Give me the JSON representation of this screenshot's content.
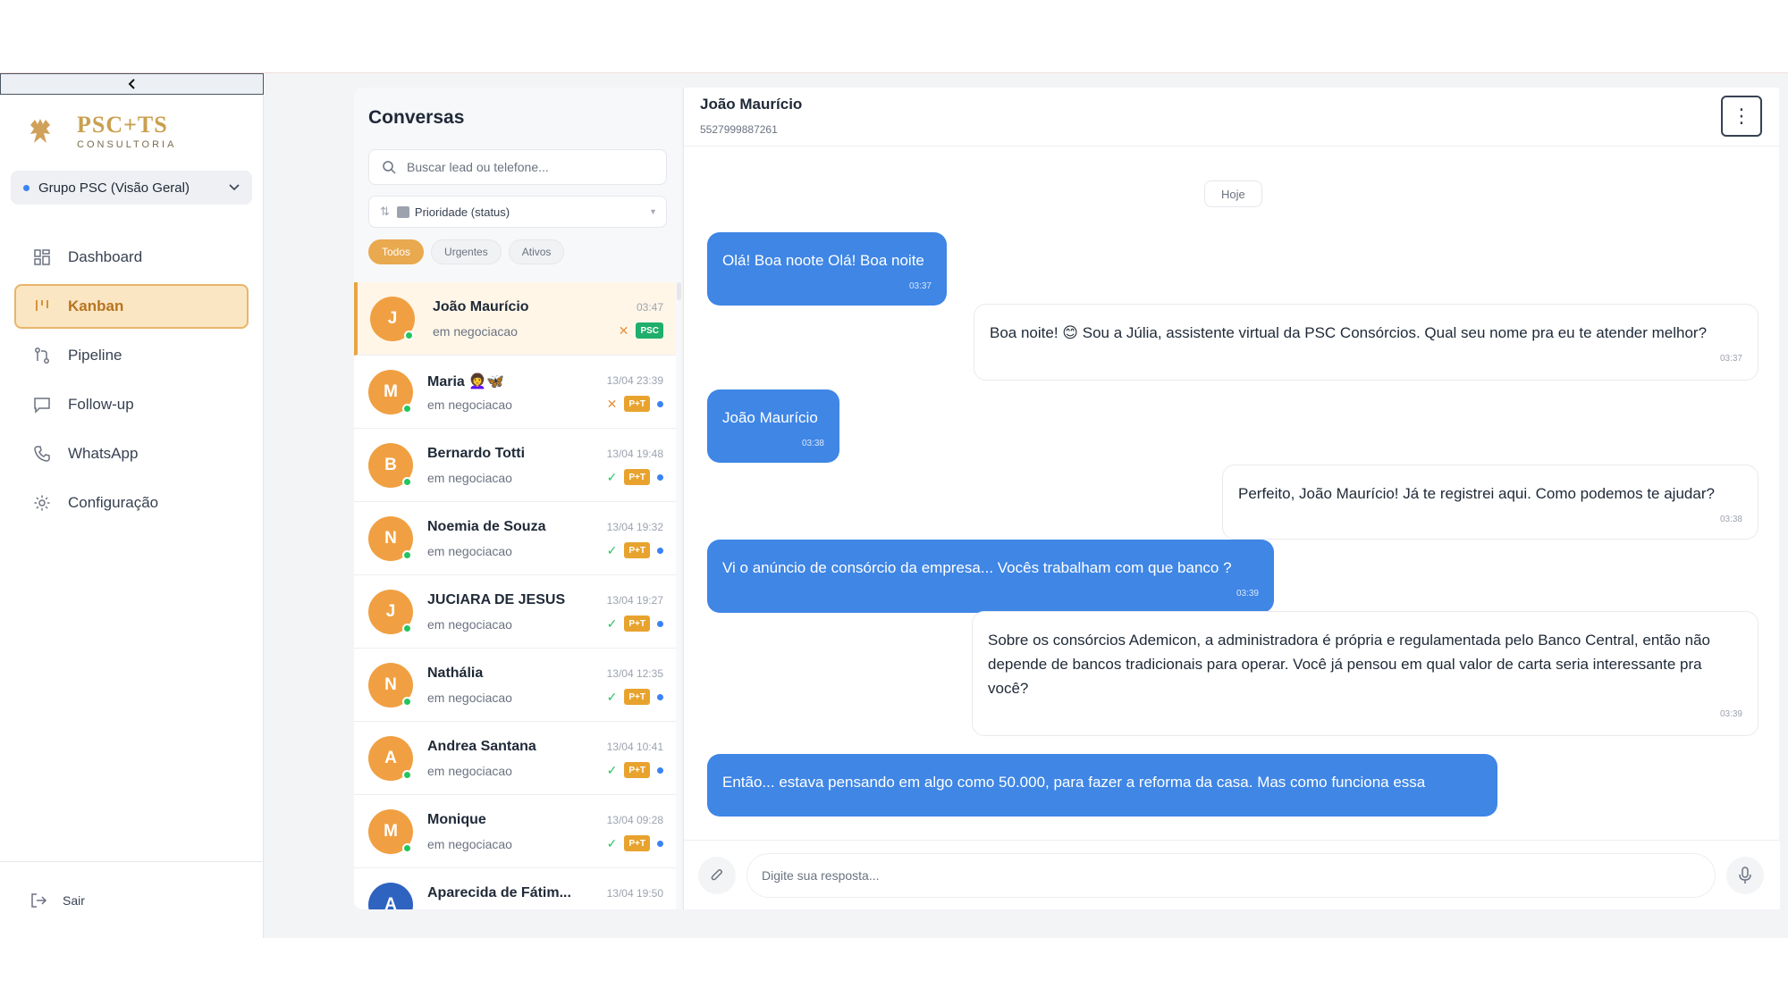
{
  "sidebar": {
    "collapse_icon": "chevron-left-icon",
    "brand": {
      "name": "PSC+TS",
      "sub": "CONSULTORIA"
    },
    "group": {
      "label": "Grupo PSC (Visão Geral)",
      "dot_color": "#3b82f6"
    },
    "nav": [
      {
        "label": "Dashboard",
        "icon": "grid-icon",
        "active": false
      },
      {
        "label": "Kanban",
        "icon": "kanban-icon",
        "active": true
      },
      {
        "label": "Pipeline",
        "icon": "pipeline-icon",
        "active": false
      },
      {
        "label": "Follow-up",
        "icon": "message-square-icon",
        "active": false
      },
      {
        "label": "WhatsApp",
        "icon": "phone-icon",
        "active": false
      },
      {
        "label": "Configuração",
        "icon": "gear-icon",
        "active": false
      }
    ],
    "logout_label": "Sair"
  },
  "conversations": {
    "title": "Conversas",
    "search_placeholder": "Buscar lead ou telefone...",
    "sort_label": "Prioridade (status)",
    "filters": [
      {
        "label": "Todos",
        "active": true
      },
      {
        "label": "Urgentes",
        "active": false
      },
      {
        "label": "Ativos",
        "active": false
      }
    ],
    "items": [
      {
        "initial": "J",
        "name": "João Maurício",
        "time": "03:47",
        "status": "em negociacao",
        "mark": "x",
        "badge": "PSC",
        "badge_color": "#1fae6b",
        "dot": false,
        "selected": true
      },
      {
        "initial": "M",
        "name": "Maria 👩‍🦱🦋",
        "time": "13/04 23:39",
        "status": "em negociacao",
        "mark": "x",
        "badge": "P+T",
        "badge_color": "#e8a32e",
        "dot": true,
        "selected": false
      },
      {
        "initial": "B",
        "name": "Bernardo Totti",
        "time": "13/04 19:48",
        "status": "em negociacao",
        "mark": "check",
        "badge": "P+T",
        "badge_color": "#e8a32e",
        "dot": true,
        "selected": false
      },
      {
        "initial": "N",
        "name": "Noemia de Souza",
        "time": "13/04 19:32",
        "status": "em negociacao",
        "mark": "check",
        "badge": "P+T",
        "badge_color": "#e8a32e",
        "dot": true,
        "selected": false
      },
      {
        "initial": "J",
        "name": "JUCIARA DE JESUS",
        "time": "13/04 19:27",
        "status": "em negociacao",
        "mark": "check",
        "badge": "P+T",
        "badge_color": "#e8a32e",
        "dot": true,
        "selected": false
      },
      {
        "initial": "N",
        "name": "Nathália",
        "time": "13/04 12:35",
        "status": "em negociacao",
        "mark": "check",
        "badge": "P+T",
        "badge_color": "#e8a32e",
        "dot": true,
        "selected": false
      },
      {
        "initial": "A",
        "name": "Andrea Santana",
        "time": "13/04 10:41",
        "status": "em negociacao",
        "mark": "check",
        "badge": "P+T",
        "badge_color": "#e8a32e",
        "dot": true,
        "selected": false
      },
      {
        "initial": "M",
        "name": "Monique",
        "time": "13/04 09:28",
        "status": "em negociacao",
        "mark": "check",
        "badge": "P+T",
        "badge_color": "#e8a32e",
        "dot": true,
        "selected": false
      },
      {
        "initial": "A",
        "name": "Aparecida de Fátim...",
        "time": "13/04 19:50",
        "status": "",
        "mark": "",
        "badge": "",
        "badge_color": "#e8a32e",
        "dot": false,
        "selected": false,
        "avatar_color": "#2e63c0"
      }
    ]
  },
  "chat": {
    "contact_name": "João Maurício",
    "contact_phone": "5527999887261",
    "menu_icon": "more-vertical-icon",
    "day_label": "Hoje",
    "messages": [
      {
        "dir": "out",
        "text": "Olá! Boa noote Olá! Boa noite",
        "time": "03:37"
      },
      {
        "dir": "in",
        "text": "Boa noite! 😊 Sou a Júlia, assistente virtual da PSC Consórcios. Qual seu nome pra eu te atender melhor?",
        "time": "03:37"
      },
      {
        "dir": "out",
        "text": "João Maurício",
        "time": "03:38"
      },
      {
        "dir": "in",
        "text": "Perfeito, João Maurício! Já te registrei aqui. Como podemos te ajudar?",
        "time": "03:38"
      },
      {
        "dir": "out",
        "text": "Vi o anúncio de consórcio da empresa... Vocês trabalham com que banco ?",
        "time": "03:39"
      },
      {
        "dir": "in",
        "text": "Sobre os consórcios Ademicon, a administradora é própria e regulamentada pelo Banco Central, então não depende de bancos tradicionais para operar. Você já pensou em qual valor de carta seria interessante pra você?",
        "time": "03:39"
      },
      {
        "dir": "out",
        "text": "Então... estava pensando em algo como 50.000, para fazer a reforma da casa. Mas como funciona essa",
        "time": ""
      }
    ],
    "composer_placeholder": "Digite sua resposta...",
    "attach_icon": "paperclip-icon",
    "mic_icon": "microphone-icon"
  }
}
